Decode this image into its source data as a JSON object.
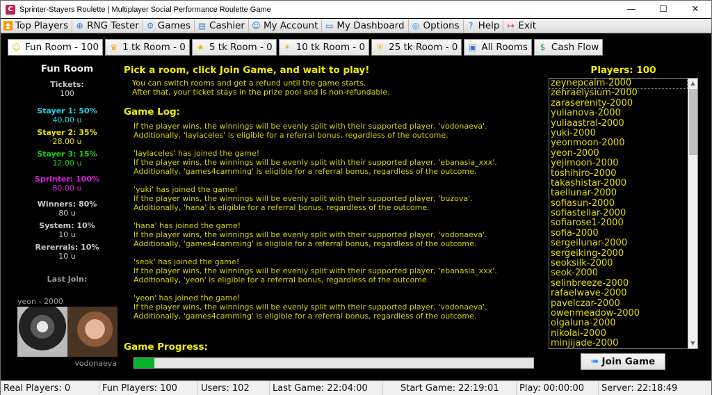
{
  "window": {
    "title": "Sprinter-Stayers Roulette | Multiplayer Social Performance Roulette Game",
    "app_icon_letter": "C",
    "controls": {
      "minimize": "—",
      "maximize": "☐",
      "close": "✕"
    }
  },
  "menu": [
    {
      "label": "Top Players",
      "icon": "⏫",
      "icon_name": "top-players-icon",
      "color": "#1a7ad6"
    },
    {
      "label": "RNG Tester",
      "icon": "⊕",
      "icon_name": "compass-icon",
      "color": "#2a6fd0"
    },
    {
      "label": "Games",
      "icon": "⚙",
      "icon_name": "gear-icon",
      "color": "#3a8fe0"
    },
    {
      "label": "Cashier",
      "icon": "▤",
      "icon_name": "calculator-icon",
      "color": "#3a8fe0"
    },
    {
      "label": "My Account",
      "icon": "☺",
      "icon_name": "user-icon",
      "color": "#2a7ad0"
    },
    {
      "label": "My Dashboard",
      "icon": "▭",
      "icon_name": "monitor-icon",
      "color": "#2a6fd0"
    },
    {
      "label": "Options",
      "icon": "◎",
      "icon_name": "options-icon",
      "color": "#2a8fe8"
    },
    {
      "label": "Help",
      "icon": "?",
      "icon_name": "help-icon",
      "color": "#2a7ad6"
    },
    {
      "label": "Exit",
      "icon": "↦",
      "icon_name": "exit-icon",
      "color": "#d03020"
    }
  ],
  "rooms": [
    {
      "label": "Fun Room - 100",
      "icon": "☺",
      "icon_name": "smiley-icon",
      "color": "#e8b400",
      "active": true
    },
    {
      "label": "1 tk Room - 0",
      "icon": "♛",
      "icon_name": "crown-icon",
      "color": "#e8b400",
      "active": false
    },
    {
      "label": "5 tk Room - 0",
      "icon": "★",
      "icon_name": "star-icon",
      "color": "#f0b800",
      "active": false
    },
    {
      "label": "10 tk Room - 0",
      "icon": "☀",
      "icon_name": "sun-icon",
      "color": "#f0b800",
      "active": false
    },
    {
      "label": "25 tk Room - 0",
      "icon": "⛨",
      "icon_name": "shield-icon",
      "color": "#e8b400",
      "active": false
    },
    {
      "label": "All Rooms",
      "icon": "▣",
      "icon_name": "tv-icon",
      "color": "#2a7ad6",
      "active": false
    },
    {
      "label": "Cash Flow",
      "icon": "$",
      "icon_name": "dollar-icon",
      "color": "#22a040",
      "active": false
    }
  ],
  "left": {
    "room_title": "Fun Room",
    "tickets_label": "Tickets:",
    "tickets_value": "100",
    "stayer1_label": "Stayer 1: 50%",
    "stayer1_value": "40.00 u",
    "stayer2_label": "Stayer 2: 35%",
    "stayer2_value": "28.00 u",
    "stayer3_label": "Stayer 3: 15%",
    "stayer3_value": "12.00 u",
    "sprinter_label": "Sprinter: 100%",
    "sprinter_value": "80.00 u",
    "winners_label": "Winners: 80%",
    "winners_value": "80 u",
    "system_label": "System: 10%",
    "system_value": "10 u",
    "referrals_label": "Rererrals: 10%",
    "referrals_value": "10 u",
    "last_join_label": "Last Join:",
    "last_join_user": "yeon  -  2000",
    "supported_player": "vodonaeva"
  },
  "center": {
    "headline": "Pick a room, click Join Game, and wait to play!",
    "note_line1": "You can switch rooms and get a refund until the game starts.",
    "note_line2": "After that, your ticket stays in the prize pool and is non-refundable.",
    "log_title": "Game Log:",
    "log": [
      {
        "lines": [
          "If the player wins, the winnings will be evenly split with their supported player, 'vodonaeva'.",
          "Additionally, 'laylaceles' is eligible for a referral bonus, regardless of the outcome."
        ]
      },
      {
        "lines": [
          "'laylaceles' has joined the game!",
          "If the player wins, the winnings will be evenly split with their supported player, 'ebanasia_xxx'.",
          "Additionally, 'games4camming' is eligible for a referral bonus, regardless of the outcome."
        ]
      },
      {
        "lines": [
          "'yuki' has joined the game!",
          "If the player wins, the winnings will be evenly split with their supported player, 'buzova'.",
          "Additionally, 'hana' is eligible for a referral bonus, regardless of the outcome."
        ]
      },
      {
        "lines": [
          "'hana' has joined the game!",
          "If the player wins, the winnings will be evenly split with their supported player, 'vodonaeva'.",
          "Additionally, 'games4camming' is eligible for a referral bonus, regardless of the outcome."
        ]
      },
      {
        "lines": [
          "'seok' has joined the game!",
          "If the player wins, the winnings will be evenly split with their supported player, 'ebanasia_xxx'.",
          "Additionally, 'yeon' is eligible for a referral bonus, regardless of the outcome."
        ]
      },
      {
        "lines": [
          "'yeon' has joined the game!",
          "If the player wins, the winnings will be evenly split with their supported player, 'vodonaeva'.",
          "Additionally, 'games4camming' is eligible for a referral bonus, regardless of the outcome."
        ]
      }
    ],
    "progress_title": "Game Progress:",
    "progress_percent": 5
  },
  "right": {
    "players_title": "Players: 100",
    "players": [
      "zeynepcalm-2000",
      "zehraelysium-2000",
      "zaraserenity-2000",
      "yulianova-2000",
      "yuliaastral-2000",
      "yuki-2000",
      "yeonmoon-2000",
      "yeon-2000",
      "yejimoon-2000",
      "toshihiro-2000",
      "takashistar-2000",
      "taellunar-2000",
      "sofiasun-2000",
      "sofiastellar-2000",
      "sofiarose1-2000",
      "sofia-2000",
      "sergeilunar-2000",
      "sergeiking-2000",
      "seoksilk-2000",
      "seok-2000",
      "selinbreeze-2000",
      "rafaelwave-2000",
      "pavelczar-2000",
      "owenmeadow-2000",
      "olgaluna-2000",
      "nikolai-2000",
      "minjijade-2000"
    ],
    "selected_index": 0,
    "join_button": "Join Game"
  },
  "status": {
    "real_players": "Real Players: 0",
    "fun_players": "Fun Players: 100",
    "users": "Users: 102",
    "last_game": "Last Game: 22:04:00",
    "start_game": "Start Game: 22:19:01",
    "play": "Play: 00:00:00",
    "server": "Server: 22:18:49"
  }
}
